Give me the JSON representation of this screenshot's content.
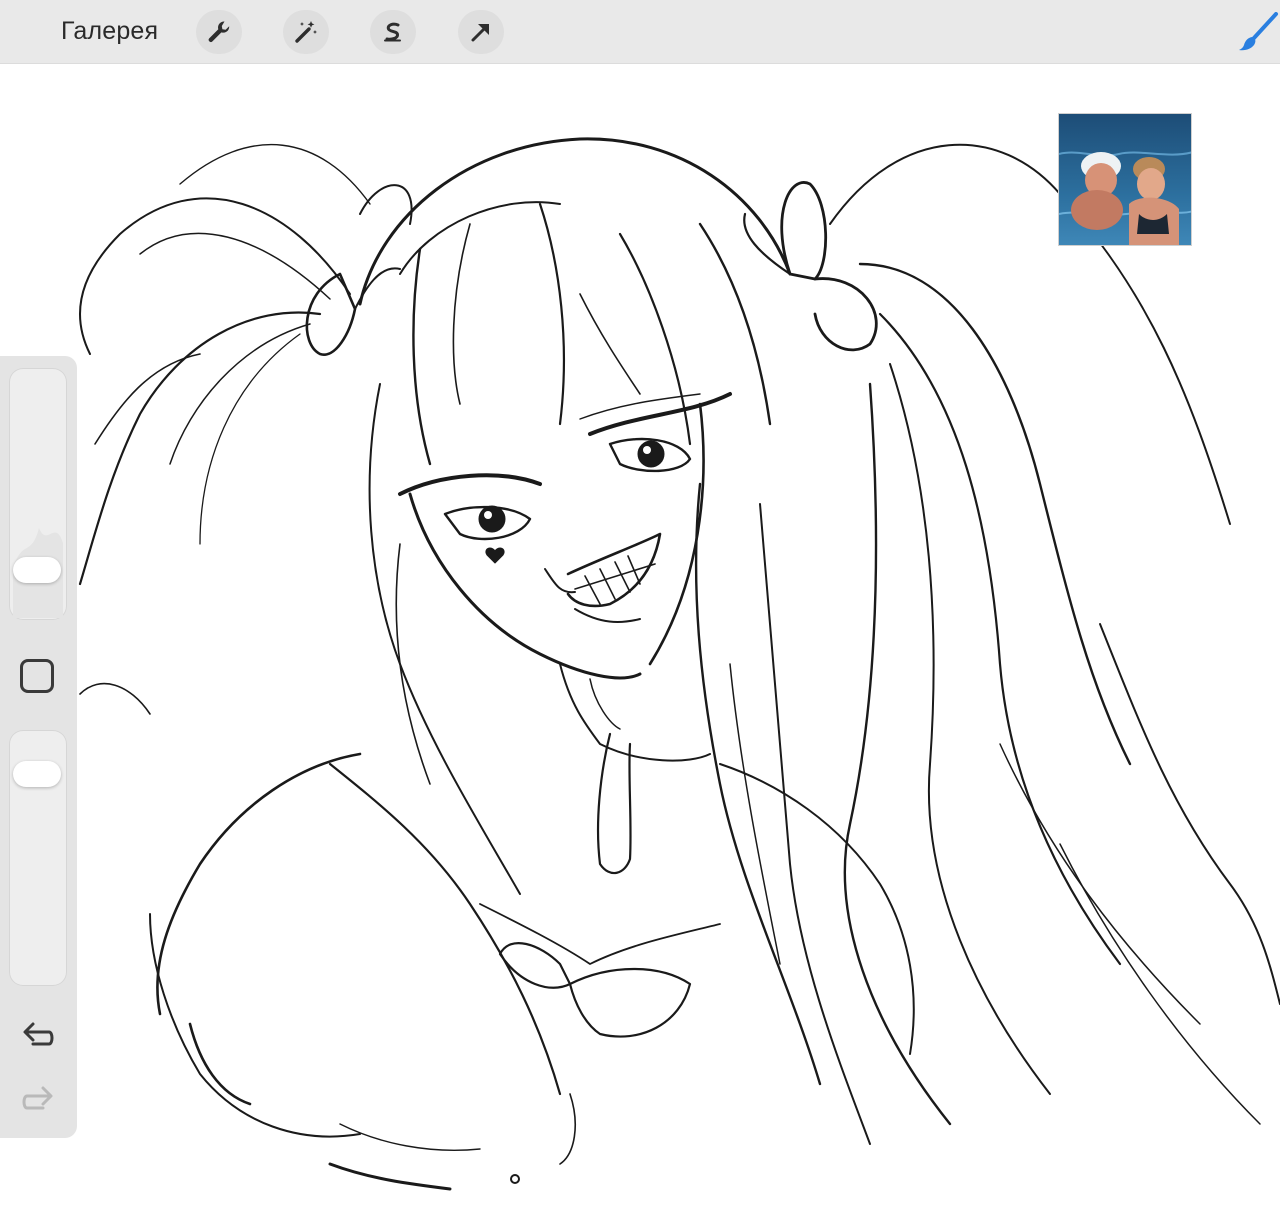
{
  "toolbar": {
    "gallery_label": "Галерея",
    "tools": [
      {
        "name": "wrench-icon"
      },
      {
        "name": "magic-wand-icon"
      },
      {
        "name": "selection-s-icon"
      },
      {
        "name": "transform-arrow-icon"
      }
    ],
    "brush_icon": "brush-icon",
    "accent": "#2a7fe0"
  },
  "sidebar": {
    "brush_size_level": 0.85,
    "opacity_level": 0.12,
    "modify_icon": "square-icon",
    "undo_icon": "undo-icon",
    "redo_icon": "redo-icon"
  },
  "reference": {
    "icon": "reference-photo"
  }
}
